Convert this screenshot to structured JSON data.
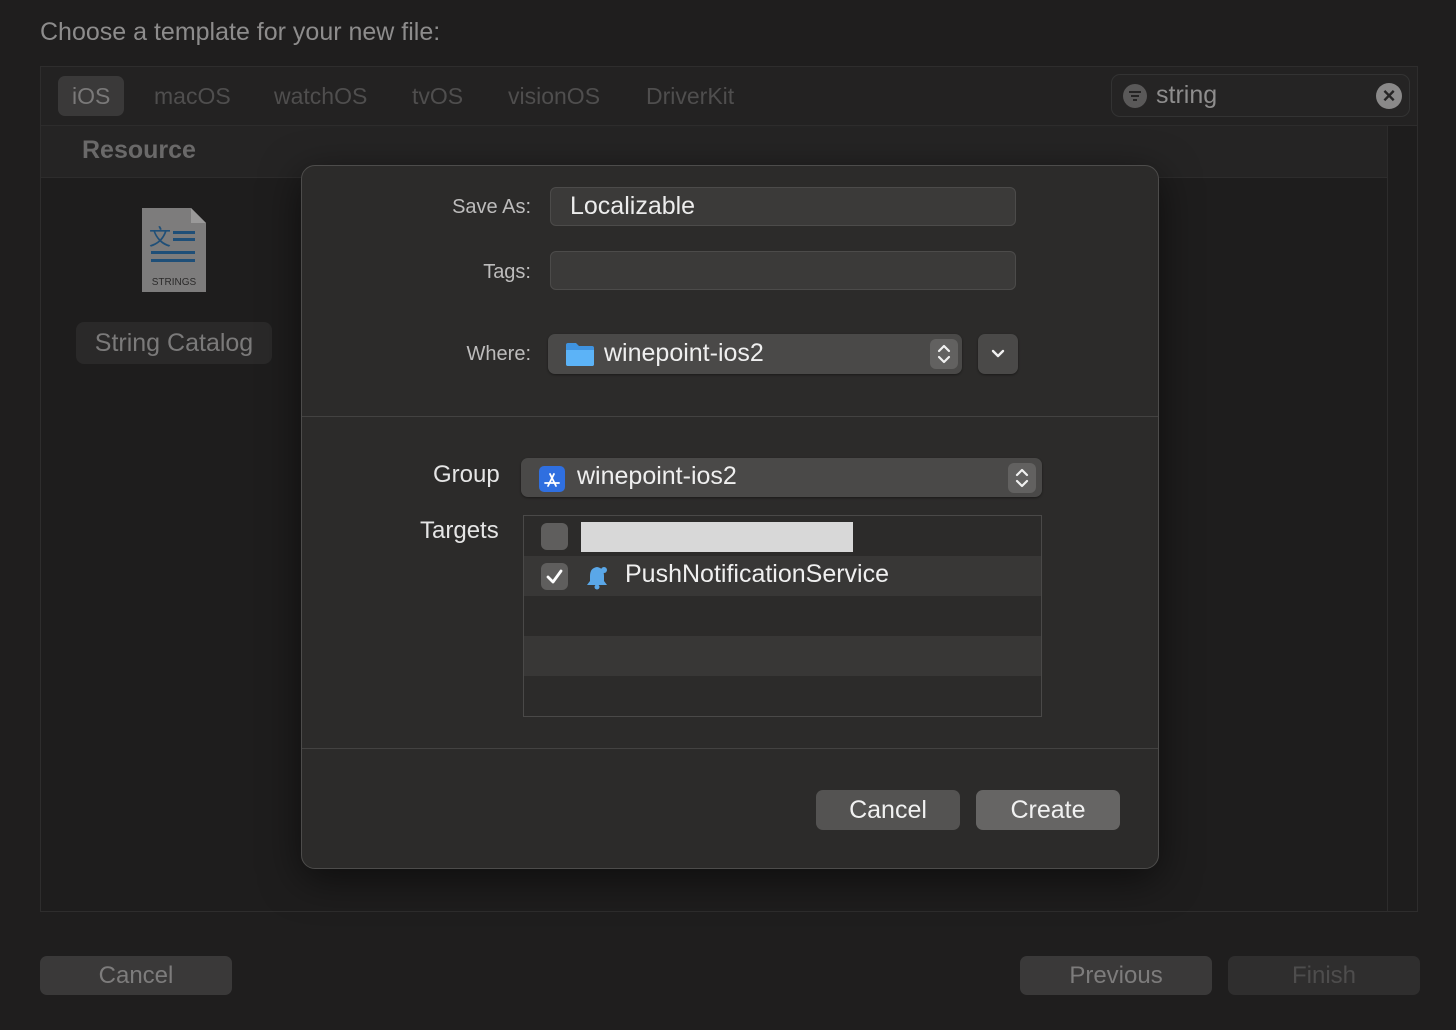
{
  "window": {
    "prompt": "Choose a template for your new file:",
    "platform_tabs": [
      {
        "label": "iOS",
        "active": true
      },
      {
        "label": "macOS"
      },
      {
        "label": "watchOS"
      },
      {
        "label": "tvOS"
      },
      {
        "label": "visionOS"
      },
      {
        "label": "DriverKit"
      }
    ],
    "search": {
      "value": "string",
      "filter_icon": "filter-icon",
      "clear_icon": "clear-icon"
    },
    "section_label": "Resource",
    "template": {
      "icon_caption": "STRINGS",
      "name": "String Catalog"
    },
    "footer": {
      "cancel": "Cancel",
      "previous": "Previous",
      "finish": "Finish"
    }
  },
  "sheet": {
    "save_as": {
      "label": "Save As:",
      "value": "Localizable"
    },
    "tags": {
      "label": "Tags:",
      "value": ""
    },
    "where": {
      "label": "Where:",
      "value": "winepoint-ios2",
      "icon": "folder-icon"
    },
    "group": {
      "label": "Group",
      "value": "winepoint-ios2",
      "icon": "app-store-icon"
    },
    "targets": {
      "label": "Targets",
      "rows": [
        {
          "name": "",
          "checked": false,
          "redacted": true
        },
        {
          "name": "PushNotificationService",
          "checked": true,
          "icon": "bell-icon"
        }
      ]
    },
    "buttons": {
      "cancel": "Cancel",
      "create": "Create"
    }
  },
  "colors": {
    "background": "#1f1e1e",
    "sheet": "#2c2b2a",
    "folder_blue": "#4aa8f5",
    "app_icon_blue": "#2f6fe0",
    "bell_blue": "#5aa7e8"
  }
}
